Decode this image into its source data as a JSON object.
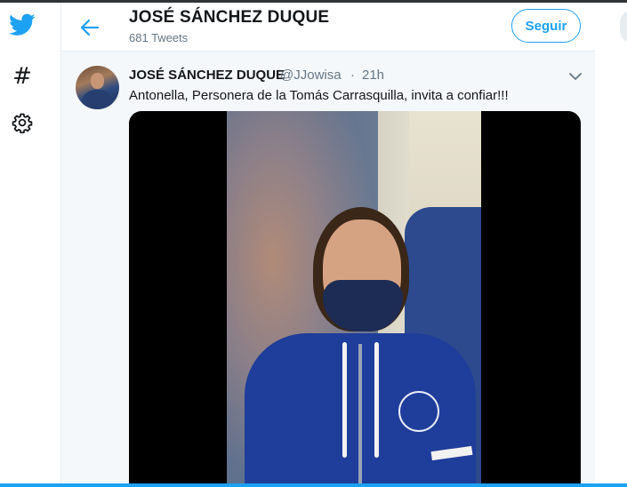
{
  "nav": {
    "icons": [
      "twitter-bird-icon",
      "explore-hash-icon",
      "settings-gear-icon"
    ],
    "hash_glyph": "#"
  },
  "header": {
    "profile_name": "JOSÉ SÁNCHEZ DUQUE",
    "tweet_count": "681 Tweets",
    "follow_label": "Seguir"
  },
  "tweet": {
    "author_name": "JOSÉ SÁNCHEZ DUQUE",
    "handle": "@JJowisa",
    "separator": "·",
    "time": "21h",
    "text": "Antonella, Personera de la Tomás Carrasquilla, invita a confiar!!!"
  },
  "colors": {
    "accent": "#1da1f2",
    "text_primary": "#14171a",
    "text_secondary": "#657786",
    "column_bg": "#f5f8fa"
  }
}
